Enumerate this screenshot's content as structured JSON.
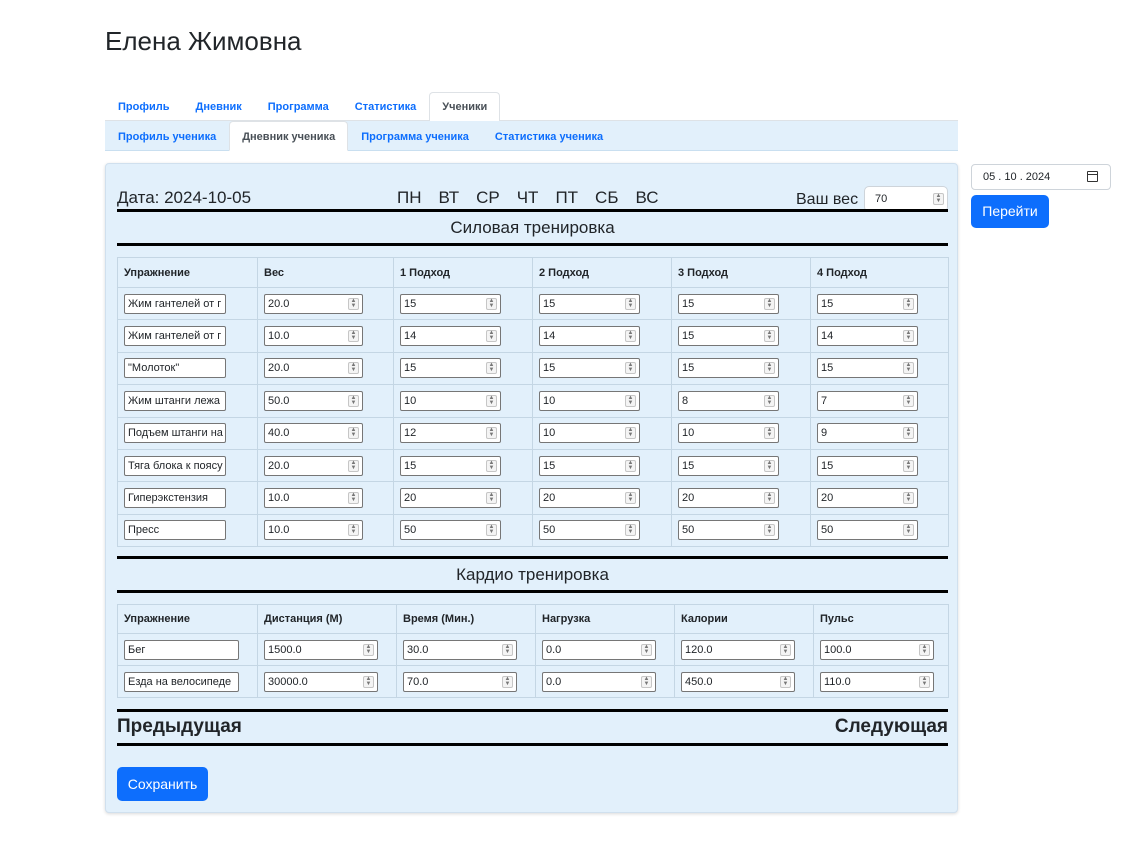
{
  "page_title": "Елена Жимовна",
  "main_tabs": [
    {
      "label": "Профиль"
    },
    {
      "label": "Дневник"
    },
    {
      "label": "Программа"
    },
    {
      "label": "Статистика"
    },
    {
      "label": "Ученики",
      "active": true
    }
  ],
  "sub_tabs": [
    {
      "label": "Профиль ученика"
    },
    {
      "label": "Дневник ученика",
      "active": true
    },
    {
      "label": "Программа ученика"
    },
    {
      "label": "Статистика ученика"
    }
  ],
  "diary": {
    "date_label": "Дата: 2024-10-05",
    "days": [
      "ПН",
      "ВТ",
      "СР",
      "ЧТ",
      "ПТ",
      "СБ",
      "ВС"
    ],
    "weight_label": "Ваш вес",
    "weight_value": "70"
  },
  "strength": {
    "title": "Силовая тренировка",
    "headers": [
      "Упражнение",
      "Вес",
      "1 Подход",
      "2 Подход",
      "3 Подход",
      "4 Подход"
    ],
    "rows": [
      {
        "exercise": "Жим гантелей от г",
        "weight": "20.0",
        "sets": [
          "15",
          "15",
          "15",
          "15"
        ]
      },
      {
        "exercise": "Жим гантелей от г",
        "weight": "10.0",
        "sets": [
          "14",
          "14",
          "15",
          "14"
        ]
      },
      {
        "exercise": "\"Молоток\"",
        "weight": "20.0",
        "sets": [
          "15",
          "15",
          "15",
          "15"
        ]
      },
      {
        "exercise": "Жим штанги лежа",
        "weight": "50.0",
        "sets": [
          "10",
          "10",
          "8",
          "7"
        ]
      },
      {
        "exercise": "Подъем штанги на",
        "weight": "40.0",
        "sets": [
          "12",
          "10",
          "10",
          "9"
        ]
      },
      {
        "exercise": "Тяга блока к поясу",
        "weight": "20.0",
        "sets": [
          "15",
          "15",
          "15",
          "15"
        ]
      },
      {
        "exercise": "Гиперэкстензия",
        "weight": "10.0",
        "sets": [
          "20",
          "20",
          "20",
          "20"
        ]
      },
      {
        "exercise": "Пресс",
        "weight": "10.0",
        "sets": [
          "50",
          "50",
          "50",
          "50"
        ]
      }
    ]
  },
  "cardio": {
    "title": "Кардио тренировка",
    "headers": [
      "Упражнение",
      "Дистанция (М)",
      "Время (Мин.)",
      "Нагрузка",
      "Калории",
      "Пульс"
    ],
    "rows": [
      {
        "exercise": "Бег",
        "values": [
          "1500.0",
          "30.0",
          "0.0",
          "120.0",
          "100.0"
        ]
      },
      {
        "exercise": "Езда на велосипеде",
        "values": [
          "30000.0",
          "70.0",
          "0.0",
          "450.0",
          "110.0"
        ]
      }
    ]
  },
  "nav": {
    "prev": "Предыдущая",
    "next": "Следующая"
  },
  "save_label": "Сохранить",
  "date_picker_value": "05 . 10 . 2024",
  "go_label": "Перейти"
}
